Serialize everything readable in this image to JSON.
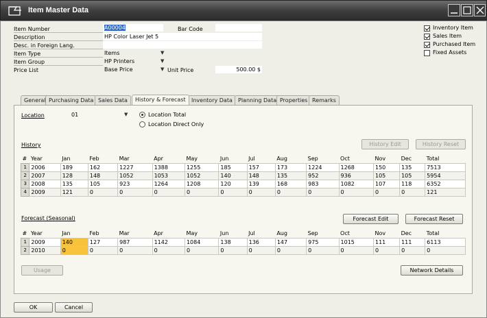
{
  "window": {
    "title": "Item Master Data"
  },
  "header": {
    "item_number": {
      "label": "Item Number",
      "value": "A00004"
    },
    "bar_code": {
      "label": "Bar Code",
      "value": ""
    },
    "description": {
      "label": "Description",
      "value": "HP Color Laser Jet 5"
    },
    "desc_foreign": {
      "label": "Desc. in Foreign Lang.",
      "value": ""
    },
    "item_type": {
      "label": "Item Type",
      "value": "Items"
    },
    "item_group": {
      "label": "Item Group",
      "value": "HP Printers"
    },
    "price_list": {
      "label": "Price List",
      "value": "Base Price"
    },
    "unit_price": {
      "label": "Unit Price",
      "value": "500.00 $"
    }
  },
  "checkboxes": [
    {
      "label": "Inventory Item",
      "checked": true
    },
    {
      "label": "Sales Item",
      "checked": true
    },
    {
      "label": "Purchased Item",
      "checked": true
    },
    {
      "label": "Fixed Assets",
      "checked": false
    }
  ],
  "tabs": [
    "General",
    "Purchasing Data",
    "Sales Data",
    "History & Forecast",
    "Inventory Data",
    "Planning Data",
    "Properties",
    "Remarks"
  ],
  "active_tab": "History & Forecast",
  "location": {
    "label": "Location",
    "value": "01",
    "radio_total": "Location Total",
    "radio_direct": "Location Direct Only",
    "selected": "Location Total"
  },
  "history": {
    "title": "History",
    "edit_button": "History Edit",
    "reset_button": "History Reset",
    "columns": [
      "#",
      "Year",
      "Jan",
      "Feb",
      "Mar",
      "Apr",
      "May",
      "Jun",
      "Jul",
      "Aug",
      "Sep",
      "Oct",
      "Nov",
      "Dec",
      "Total"
    ],
    "rows": [
      [
        "1",
        "2006",
        "189",
        "162",
        "1227",
        "1388",
        "1255",
        "185",
        "157",
        "173",
        "1224",
        "1268",
        "150",
        "135",
        "7513"
      ],
      [
        "2",
        "2007",
        "128",
        "148",
        "1052",
        "1053",
        "1052",
        "140",
        "148",
        "135",
        "952",
        "936",
        "105",
        "105",
        "5954"
      ],
      [
        "3",
        "2008",
        "135",
        "105",
        "923",
        "1264",
        "1208",
        "120",
        "139",
        "168",
        "983",
        "1082",
        "107",
        "118",
        "6352"
      ],
      [
        "4",
        "2009",
        "121",
        "0",
        "0",
        "0",
        "0",
        "0",
        "0",
        "0",
        "0",
        "0",
        "0",
        "0",
        "121"
      ]
    ]
  },
  "forecast": {
    "title": "Forecast (Seasonal)",
    "edit_button": "Forecast Edit",
    "reset_button": "Forecast Reset",
    "columns": [
      "#",
      "Year",
      "Jan",
      "Feb",
      "Mar",
      "Apr",
      "May",
      "Jun",
      "Jul",
      "Aug",
      "Sep",
      "Oct",
      "Nov",
      "Dec",
      "Total"
    ],
    "rows": [
      [
        "1",
        "2009",
        "140",
        "127",
        "987",
        "1142",
        "1084",
        "138",
        "136",
        "147",
        "975",
        "1015",
        "111",
        "111",
        "6113"
      ],
      [
        "2",
        "2010",
        "0",
        "0",
        "0",
        "0",
        "0",
        "0",
        "0",
        "0",
        "0",
        "0",
        "0",
        "0",
        "0"
      ]
    ],
    "highlight_color": "#f8c23a"
  },
  "buttons": {
    "usage": "Usage",
    "network_details": "Network Details",
    "ok": "OK",
    "cancel": "Cancel"
  }
}
